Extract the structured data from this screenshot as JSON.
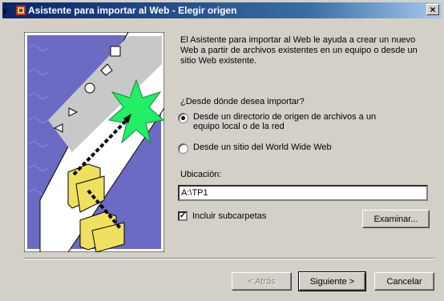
{
  "window": {
    "title": "Asistente para importar al Web - Elegir origen",
    "corner_glyph": "V",
    "close_glyph": "×"
  },
  "intro_text": "El Asistente para importar al Web le ayuda a crear un nuevo Web a partir de archivos existentes en un equipo o desde un sitio Web existente.",
  "question": "¿Desde dónde desea importar?",
  "options": [
    {
      "label": "Desde un directorio de origen de archivos a un equipo local o de la red",
      "selected": true
    },
    {
      "label": "Desde un sitio del World Wide Web",
      "selected": false
    }
  ],
  "location": {
    "label": "Ubicación:",
    "value": "A:\\TP1"
  },
  "include_subfolders": {
    "label": "Incluir subcarpetas",
    "checked": true,
    "mark": "✓"
  },
  "buttons": {
    "browse": "Examinar...",
    "back": "< Atrás",
    "next": "Siguiente >",
    "cancel": "Cancelar"
  },
  "colors": {
    "title_bar": "#0a246a",
    "dialog_face": "#d4d0c8",
    "illustration_sky": "#6b6bc4",
    "burst_green": "#22ee66",
    "folder_yellow": "#f0e060"
  }
}
